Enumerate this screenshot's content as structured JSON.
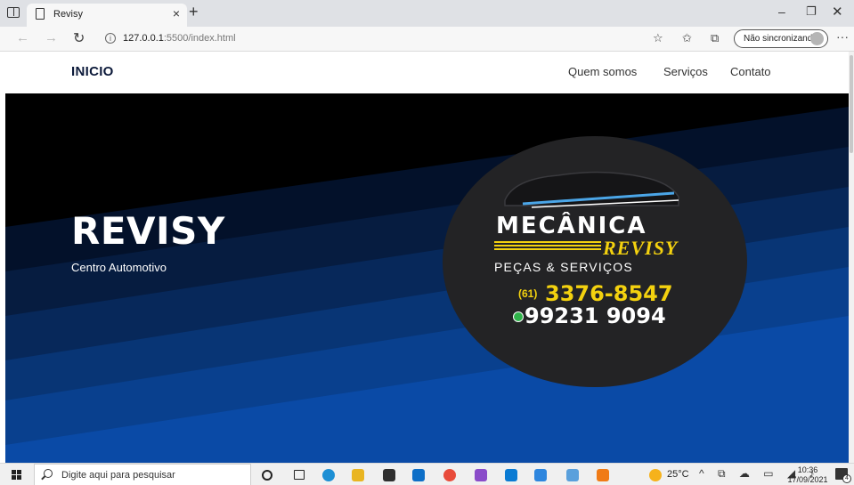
{
  "browser": {
    "tab_title": "Revisy",
    "tab_close": "×",
    "new_tab": "+",
    "url_host": "127.0.0.1",
    "url_rest": ":5500/index.html",
    "profile_label": "Não sincronizando",
    "window_min": "–",
    "window_restore": "❐",
    "window_close": "✕",
    "back": "←",
    "forward": "→",
    "refresh": "↻",
    "menu": "···",
    "fav_add": "☆",
    "favorites": "✩",
    "collections": "⧉"
  },
  "navbar": {
    "brand": "INICIO",
    "links": [
      "Quem somos",
      "Serviços",
      "Contato"
    ]
  },
  "hero": {
    "title": "REVISY",
    "subtitle": "Centro Automotivo"
  },
  "logo": {
    "brand": "MECÂNICA",
    "brand_accent": "REVISY",
    "tagline": "PEÇAS & SERVIÇOS",
    "area_code": "(61)",
    "phone": "3376-8547",
    "whatsapp": "99231 9094"
  },
  "taskbar": {
    "search_placeholder": "Digite aqui para pesquisar",
    "weather_temp": "25°C",
    "tray_symbols": "^ ⧉ ☁ ▭ ◢ ♪",
    "time": "10:36",
    "date": "17/09/2021",
    "notification_count": "4"
  },
  "colors": {
    "hero_dark": "#000000",
    "hero_blue": "#0a4aa6",
    "logo_yellow": "#f3d10f",
    "brand_navy": "#0c1a3a"
  }
}
